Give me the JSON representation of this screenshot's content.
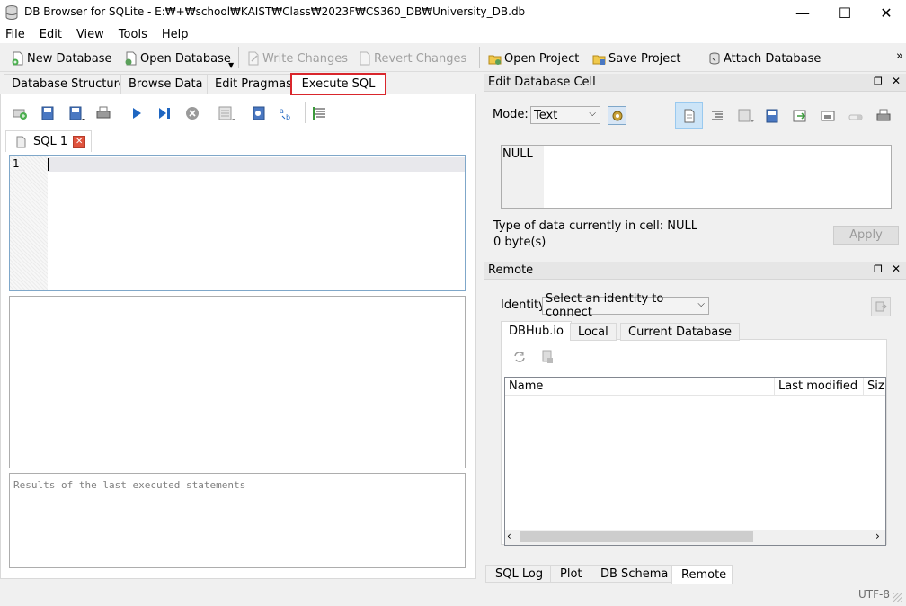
{
  "window": {
    "title": "DB Browser for SQLite - E:₩+₩school₩KAIST₩Class₩2023F₩CS360_DB₩University_DB.db",
    "minimize": "—",
    "maximize": "☐",
    "close": "✕"
  },
  "menu": [
    "File",
    "Edit",
    "View",
    "Tools",
    "Help"
  ],
  "toolbar": {
    "new_database": "New Database",
    "open_database": "Open Database",
    "write_changes": "Write Changes",
    "revert_changes": "Revert Changes",
    "open_project": "Open Project",
    "save_project": "Save Project",
    "attach_database": "Attach Database",
    "overflow": "»"
  },
  "main_tabs": [
    "Database Structure",
    "Browse Data",
    "Edit Pragmas",
    "Execute SQL"
  ],
  "active_tab": "Execute SQL",
  "sql_editor": {
    "tab_label": "SQL 1",
    "line_number": "1",
    "results_placeholder": "Results of the last executed statements"
  },
  "edit_cell": {
    "title": "Edit Database Cell",
    "mode_label": "Mode:",
    "mode_value": "Text",
    "cell_value": "NULL",
    "type_info": "Type of data currently in cell: NULL",
    "size_info": "0 byte(s)",
    "apply_label": "Apply"
  },
  "remote": {
    "title": "Remote",
    "identity_label": "Identity",
    "identity_value": "Select an identity to connect",
    "tabs": [
      "DBHub.io",
      "Local",
      "Current Database"
    ],
    "columns": [
      "Name",
      "Last modified",
      "Siz"
    ]
  },
  "bottom_tabs": [
    "SQL Log",
    "Plot",
    "DB Schema",
    "Remote"
  ],
  "status": {
    "encoding": "UTF-8"
  },
  "colors": {
    "highlight_red": "#d9262c",
    "editor_border": "#7fa7c9"
  }
}
